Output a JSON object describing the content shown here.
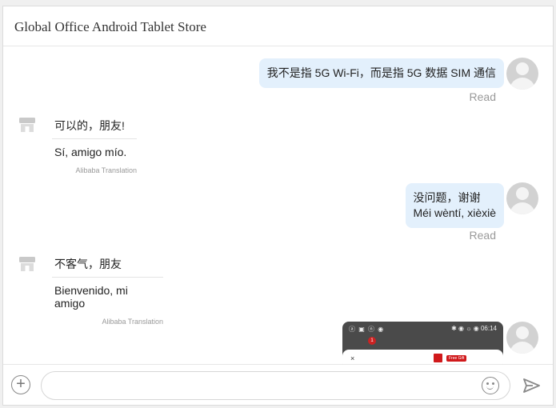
{
  "header": {
    "title": "Global Office Android Tablet Store"
  },
  "messages": {
    "m1": {
      "text": "我不是指 5G Wi-Fi，而是指 5G 数据 SIM 通信",
      "status": "Read"
    },
    "m2": {
      "original": "可以的，朋友!",
      "translation": "Sí, amigo mío.",
      "credit": "Alibaba Translation"
    },
    "m3": {
      "line1": "没问题，谢谢",
      "line2": "Méi wèntí, xièxiè",
      "status": "Read"
    },
    "m4": {
      "original": "不客气，朋友",
      "translation": "Bienvenido, mi amigo",
      "credit": "Alibaba Translation"
    },
    "m5": {
      "status_icons": "ⓐ ▣ ⓝ ◉",
      "status_right": "✱ ◉ ☼ ◉ 06:14",
      "badge": "1",
      "close": "×",
      "gift_label": "Free Gift"
    }
  },
  "composer": {
    "placeholder": ""
  },
  "icons": {
    "store": "store-icon",
    "avatar": "user-avatar-icon",
    "plus": "plus-icon",
    "emoji": "emoji-icon",
    "send": "send-icon"
  },
  "colors": {
    "bubble_out": "#e3f0fc",
    "muted": "#999999",
    "avatar": "#d2d2d2"
  }
}
